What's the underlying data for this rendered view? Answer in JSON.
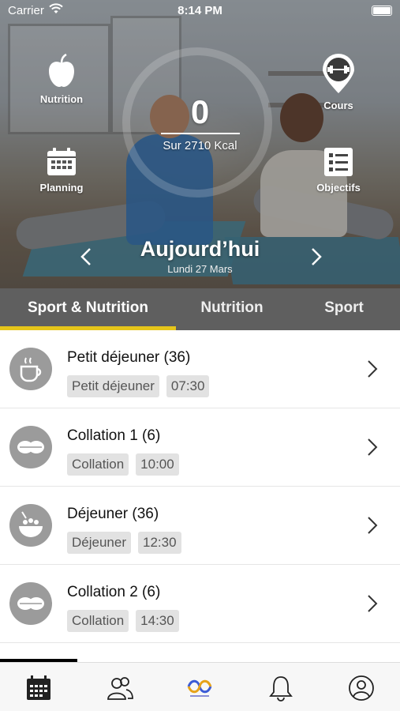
{
  "status_bar": {
    "carrier": "Carrier",
    "time": "8:14 PM"
  },
  "hero": {
    "nutrition_label": "Nutrition",
    "cours_label": "Cours",
    "planning_label": "Planning",
    "objectifs_label": "Objectifs",
    "kcal_value": "0",
    "kcal_target": "Sur 2710 Kcal",
    "day_title": "Aujourd’hui",
    "day_date": "Lundi 27 Mars"
  },
  "tabs": [
    {
      "label": "Sport & Nutrition",
      "active": true
    },
    {
      "label": "Nutrition",
      "active": false
    },
    {
      "label": "Sport",
      "active": false
    }
  ],
  "meals": [
    {
      "title": "Petit déjeuner (36)",
      "tag": "Petit déjeuner",
      "time": "07:30",
      "icon": "coffee-cup-icon"
    },
    {
      "title": "Collation  1 (6)",
      "tag": "Collation",
      "time": "10:00",
      "icon": "snack-icon"
    },
    {
      "title": "Déjeuner (36)",
      "tag": "Déjeuner",
      "time": "12:30",
      "icon": "bowl-icon"
    },
    {
      "title": "Collation  2 (6)",
      "tag": "Collation",
      "time": "14:30",
      "icon": "snack-icon"
    }
  ],
  "tab_bar": {
    "items": [
      "calendar-icon",
      "community-icon",
      "brand-logo-icon",
      "bell-icon",
      "profile-icon"
    ]
  },
  "colors": {
    "accent": "#e6c51a",
    "tabs_bg": "#5f5f5f",
    "avatar_bg": "#9b9b9b",
    "tag_bg": "#e2e2e2"
  }
}
